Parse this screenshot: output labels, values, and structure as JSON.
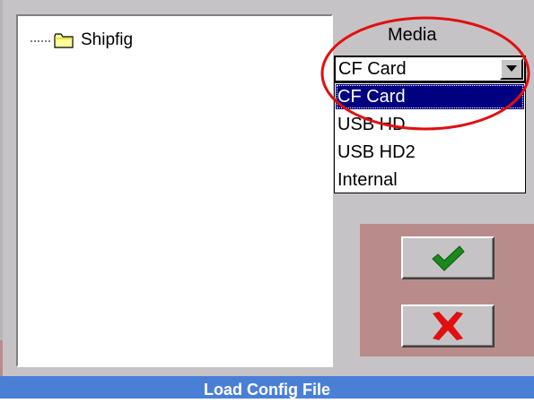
{
  "tree": {
    "items": [
      {
        "label": "Shipfig",
        "icon": "folder-icon"
      }
    ]
  },
  "media": {
    "label": "Media",
    "selected": "CF Card",
    "options": [
      "CF Card",
      "USB HD",
      "USB HD2",
      "Internal"
    ],
    "highlighted_index": 0
  },
  "buttons": {
    "ok_icon": "checkmark-icon",
    "cancel_icon": "x-icon"
  },
  "title_bar": {
    "title": "Load Config File"
  },
  "colors": {
    "dialog_bg": "#c6c3c6",
    "selection_bg": "#000080",
    "button_panel_bg": "#b98c8c",
    "title_bar_bg": "#4a7fd6",
    "annotation_ellipse": "#e01010",
    "ok_green": "#1a8a1a",
    "cancel_red": "#e01010"
  }
}
